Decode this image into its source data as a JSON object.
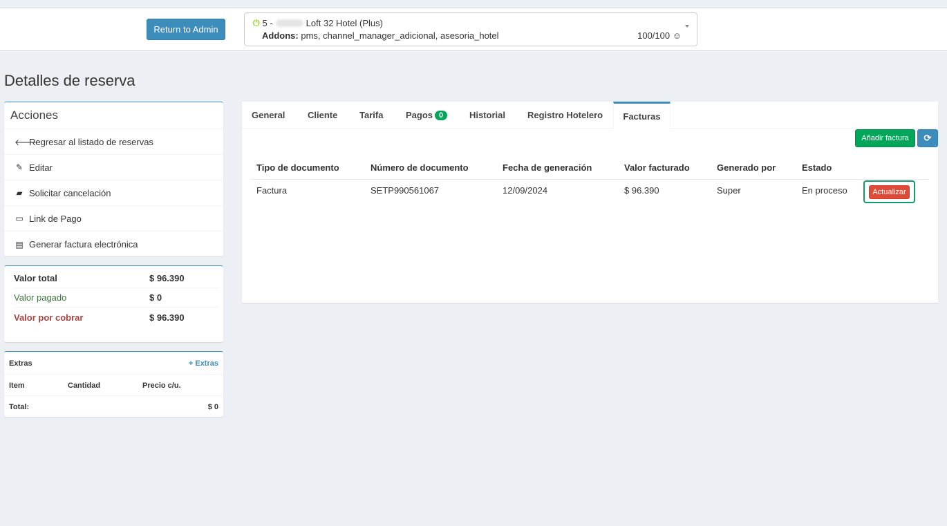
{
  "header": {
    "return_label": "Return to Admin",
    "hotel_prefix": "5 -",
    "hotel_name": "Loft 32 Hotel (Plus)",
    "addons_label": "Addons:",
    "addons_value": "pms, channel_manager_adicional, asesoria_hotel",
    "score": "100/100 ☺"
  },
  "page_title": "Detalles de reserva",
  "actions": {
    "title": "Acciones",
    "items": [
      {
        "icon": "arrow-left-icon",
        "label": "Regresar al listado de reservas"
      },
      {
        "icon": "pencil-icon",
        "label": "Editar"
      },
      {
        "icon": "book-icon",
        "label": "Solicitar cancelación"
      },
      {
        "icon": "credit-card-icon",
        "label": "Link de Pago"
      },
      {
        "icon": "file-text-icon",
        "label": "Generar factura electrónica"
      }
    ]
  },
  "totals": {
    "total_label": "Valor total",
    "total_value": "$ 96.390",
    "paid_label": "Valor pagado",
    "paid_value": "$ 0",
    "due_label": "Valor por cobrar",
    "due_value": "$ 96.390"
  },
  "extras": {
    "title": "Extras",
    "add_label": "+ Extras",
    "col_item": "Item",
    "col_qty": "Cantidad",
    "col_price": "Precio c/u.",
    "total_label": "Total:",
    "total_value": "$ 0"
  },
  "tabs": {
    "general": "General",
    "cliente": "Cliente",
    "tarifa": "Tarifa",
    "pagos": "Pagos",
    "pagos_count": "0",
    "historial": "Historial",
    "registro": "Registro Hotelero",
    "facturas": "Facturas",
    "active": "Facturas"
  },
  "invoices": {
    "add_label": "Añadir factura",
    "refresh_icon": "refresh-icon",
    "headers": [
      "Tipo de documento",
      "Número de documento",
      "Fecha de generación",
      "Valor facturado",
      "Generado por",
      "Estado"
    ],
    "rows": [
      {
        "tipo": "Factura",
        "numero": "SETP990561067",
        "fecha": "12/09/2024",
        "valor": "$ 96.390",
        "generado": "Super",
        "estado": "En proceso",
        "action": "Actualizar"
      }
    ]
  },
  "colors": {
    "primary": "#3c8dbc",
    "success": "#00a65a",
    "danger": "#dd4b39",
    "highlight": "#16996a"
  }
}
